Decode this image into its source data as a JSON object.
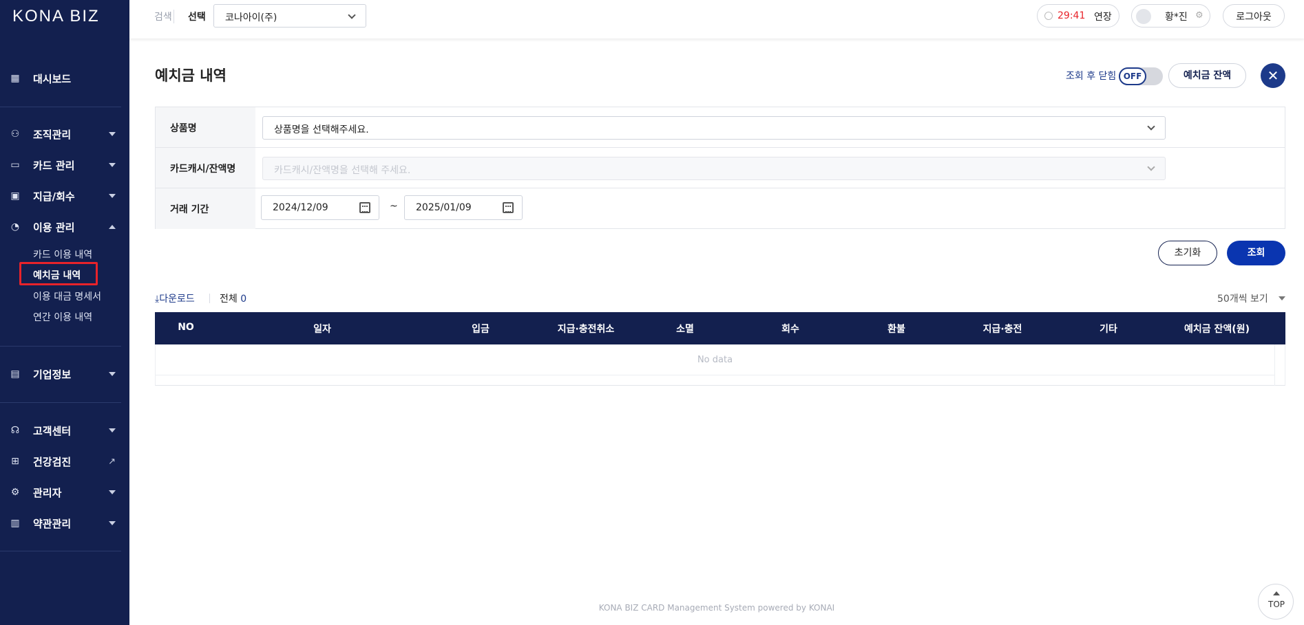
{
  "app": {
    "logo": "KONA BIZ"
  },
  "sidebar": {
    "items": [
      {
        "label": "대시보드",
        "icon": "dashboard-icon"
      },
      {
        "label": "조직관리",
        "icon": "organization-icon"
      },
      {
        "label": "카드 관리",
        "icon": "card-icon"
      },
      {
        "label": "지급/회수",
        "icon": "payment-icon"
      },
      {
        "label": "이용 관리",
        "icon": "usage-chart-icon"
      },
      {
        "label": "기업정보",
        "icon": "building-icon"
      },
      {
        "label": "고객센터",
        "icon": "headset-icon"
      },
      {
        "label": "건강검진",
        "icon": "medical-kit-icon"
      },
      {
        "label": "관리자",
        "icon": "admin-icon"
      },
      {
        "label": "약관관리",
        "icon": "document-icon"
      }
    ],
    "usage_sub": [
      "카드 이용 내역",
      "예치금 내역",
      "이용 대금 명세서",
      "연간 이용 내역"
    ],
    "active_sub": "예치금 내역"
  },
  "topbar": {
    "search_label": "검색",
    "select_label": "선택",
    "company_value": "코나아이(주)",
    "timer": "29:41",
    "extend": "연장",
    "user_name": "황*진",
    "logout": "로그아웃"
  },
  "page": {
    "title": "예치금 내역",
    "close_after_query_label": "조회 후 닫힘",
    "toggle_state": "OFF",
    "balance_button": "예치금 잔액"
  },
  "filter": {
    "product_label": "상품명",
    "product_placeholder": "상품명을 선택해주세요.",
    "cardcash_label": "카드캐시/잔액명",
    "cardcash_placeholder": "카드캐시/잔액명을 선택해 주세요.",
    "period_label": "거래 기간",
    "date_from": "2024/12/09",
    "date_to": "2025/01/09",
    "tilde": "~"
  },
  "actions": {
    "reset": "초기화",
    "search": "조회"
  },
  "list": {
    "download": "다운로드",
    "total_label": "전체",
    "total_count": "0",
    "per_page": "50개씩 보기",
    "columns": [
      "NO",
      "일자",
      "입금",
      "지급·충전취소",
      "소멸",
      "회수",
      "환불",
      "지급·충전",
      "기타",
      "예치금 잔액(원)"
    ],
    "empty": "No data"
  },
  "footer": {
    "text": "KONA BIZ CARD Management System powered by KONAI",
    "top": "TOP"
  },
  "colors": {
    "sidebar_bg": "#13204f",
    "primary": "#0a35b0",
    "timer": "#e8232a"
  }
}
